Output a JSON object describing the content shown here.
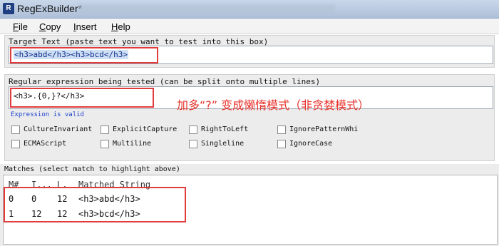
{
  "window": {
    "title": "RegExBuilder*",
    "app_icon": "R"
  },
  "menu": [
    "File",
    "Copy",
    "Insert",
    "Help"
  ],
  "target": {
    "label": "Target Text (paste text you want to test into this box)",
    "value": "<h3>abd</h3><h3>bcd</h3>"
  },
  "regex": {
    "label": "Regular expression being tested (can be split onto multiple lines)",
    "value": "<h3>.{0,}?</h3>",
    "annotation": "加多“?” 变成懒惰模式（非贪婪模式）",
    "status": "Expression is valid",
    "status_color": "#1a3fd0"
  },
  "options": [
    {
      "label": "CultureInvariant",
      "checked": false
    },
    {
      "label": "ExplicitCapture",
      "checked": false
    },
    {
      "label": "RightToLeft",
      "checked": false
    },
    {
      "label": "IgnorePatternWhi",
      "checked": false
    },
    {
      "label": "ECMAScript",
      "checked": false
    },
    {
      "label": "Multiline",
      "checked": false
    },
    {
      "label": "Singleline",
      "checked": false
    },
    {
      "label": "IgnoreCase",
      "checked": false
    }
  ],
  "matches": {
    "label": "Matches (select match to highlight above)",
    "columns": [
      "M#",
      "I...",
      "L.",
      "Matched String"
    ],
    "rows": [
      [
        "0",
        "0",
        "12",
        "<h3>abd</h3>"
      ],
      [
        "1",
        "12",
        "12",
        "<h3>bcd</h3>"
      ]
    ]
  },
  "colors": {
    "annotation": "#e8312b",
    "highlight_box": "#e23b3b",
    "selection": "#b9d3ee"
  }
}
